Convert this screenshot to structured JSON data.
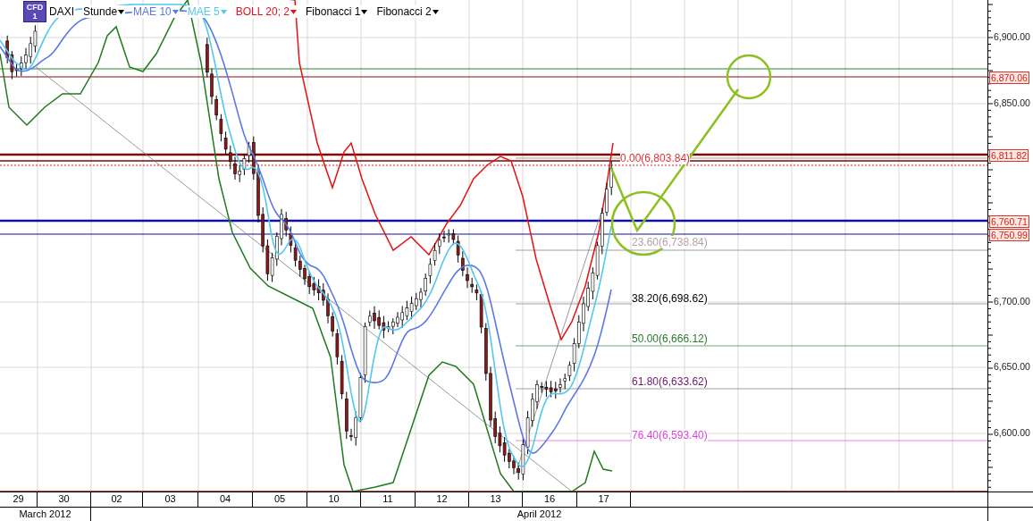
{
  "legend": [
    {
      "kind": "instrument",
      "badge_lines": [
        "CFD",
        "1"
      ],
      "label": "DAXI",
      "color": "#000000",
      "dropdown": false
    },
    {
      "kind": "timeframe",
      "label": "Stunde",
      "color": "#000000",
      "dropdown": true
    },
    {
      "kind": "indicator",
      "label": "MAE 10",
      "color": "#5b78e6",
      "dropdown": true
    },
    {
      "kind": "indicator",
      "label": "MAE 5",
      "color": "#52c8f0",
      "dropdown": true
    },
    {
      "kind": "indicator",
      "label": "BOLL 20; 2",
      "color": "#e8101e",
      "dropdown": true
    },
    {
      "kind": "indicator",
      "label": "Fibonacci 1",
      "color": "#000000",
      "dropdown": true
    },
    {
      "kind": "indicator",
      "label": "Fibonacci 2",
      "color": "#000000",
      "dropdown": true
    }
  ],
  "fibonacci_levels": [
    {
      "label": "0.00(6,803.84)",
      "color": "#e03030"
    },
    {
      "label": "23.60(6,738.84)",
      "color": "#b8a0a4"
    },
    {
      "label": "38.20(6,698.62)",
      "color": "#000000"
    },
    {
      "label": "50.00(6,666.12)",
      "color": "#2a7a2a"
    },
    {
      "label": "61.80(6,633.62)",
      "color": "#6a1a6a"
    },
    {
      "label": "76.40(6,593.40)",
      "color": "#e040e0"
    }
  ],
  "price_axis": {
    "ticks": [
      "6,900.00",
      "6,850.00",
      "6,700.00",
      "6,650.00",
      "6,600.00"
    ],
    "price_labels": [
      "6,870.06",
      "6,811.82",
      "6,760.71",
      "6,750.99"
    ]
  },
  "time_axis": {
    "days": [
      "29",
      "30",
      "02",
      "03",
      "04",
      "05",
      "10",
      "11",
      "12",
      "13",
      "16",
      "17"
    ],
    "months": [
      "March 2012",
      "April 2012"
    ]
  }
}
